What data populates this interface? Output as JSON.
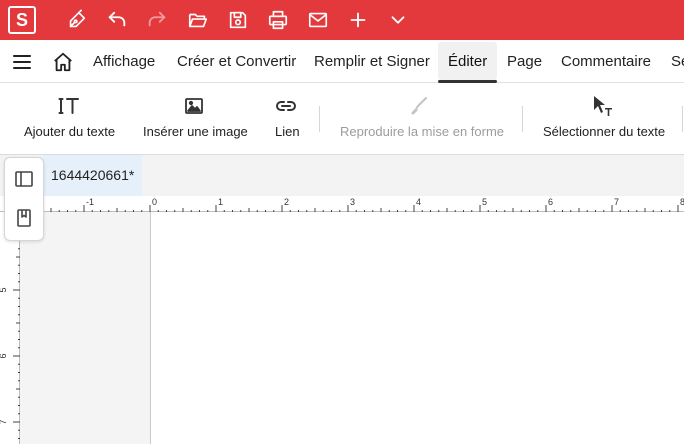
{
  "app": {
    "logo_letter": "S",
    "titlebar_color": "#e3393d",
    "titlebar_icons": [
      "pen-icon",
      "undo-icon",
      "redo-icon",
      "open-folder-icon",
      "save-icon",
      "print-icon",
      "mail-icon",
      "plus-icon",
      "chevron-down-icon"
    ]
  },
  "menu": {
    "items": [
      {
        "label": "Affichage"
      },
      {
        "label": "Créer et Convertir"
      },
      {
        "label": "Remplir et Signer"
      },
      {
        "label": "Éditer",
        "active": true
      },
      {
        "label": "Page"
      },
      {
        "label": "Commentaire"
      },
      {
        "label": "Sé"
      }
    ]
  },
  "toolbar": {
    "tools": [
      {
        "label": "Ajouter du texte",
        "icon": "add-text-icon",
        "enabled": true
      },
      {
        "label": "Insérer une image",
        "icon": "image-icon",
        "enabled": true
      },
      {
        "label": "Lien",
        "icon": "link-icon",
        "enabled": true
      },
      {
        "label": "Reproduire la mise en forme",
        "icon": "format-painter-icon",
        "enabled": false
      },
      {
        "label": "Sélectionner du texte",
        "icon": "select-text-icon",
        "enabled": true
      }
    ]
  },
  "document": {
    "tab_label": "1644420661*"
  },
  "ruler": {
    "horizontal_labels": [
      "-1",
      "0",
      "1",
      "2",
      "3",
      "4",
      "5",
      "6",
      "7",
      "8"
    ],
    "vertical_labels": [
      "5",
      "6",
      "7"
    ]
  }
}
